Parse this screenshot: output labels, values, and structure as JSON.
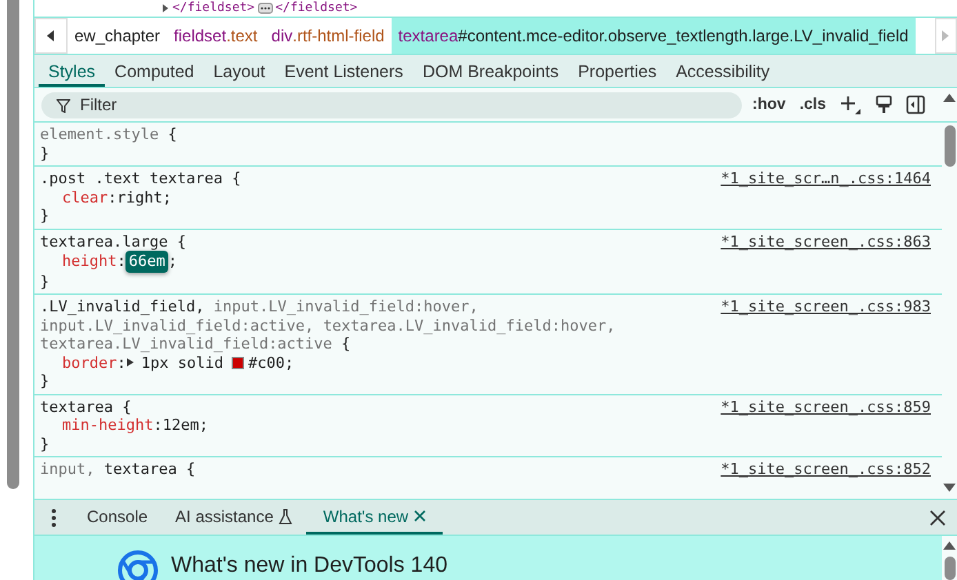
{
  "dom_fragment": {
    "open": "</fieldset>",
    "close": "</fieldset>"
  },
  "breadcrumbs": [
    {
      "suffix": "ew_chapter",
      "kind": "id",
      "selected": false
    },
    {
      "tag": "fieldset",
      "suffix": ".text",
      "kind": "class",
      "selected": false
    },
    {
      "tag": "div",
      "suffix": ".rtf-html-field",
      "kind": "class",
      "selected": false
    },
    {
      "tag": "textarea",
      "suffix": "#content.mce-editor.observe_textlength.large.LV_invalid_field",
      "kind": "id",
      "selected": true
    }
  ],
  "tabs": [
    {
      "label": "Styles",
      "selected": true
    },
    {
      "label": "Computed",
      "selected": false
    },
    {
      "label": "Layout",
      "selected": false
    },
    {
      "label": "Event Listeners",
      "selected": false
    },
    {
      "label": "DOM Breakpoints",
      "selected": false
    },
    {
      "label": "Properties",
      "selected": false
    },
    {
      "label": "Accessibility",
      "selected": false
    }
  ],
  "filter": {
    "placeholder": "Filter",
    "toggles": [
      ":hov",
      ".cls"
    ]
  },
  "rules": [
    {
      "selectors": [
        {
          "text": "element.style",
          "matched": false
        }
      ],
      "open": "{",
      "close": "}"
    },
    {
      "selectors": [
        {
          "text": ".post .text textarea",
          "matched": true
        }
      ],
      "open": "{",
      "source": "*1_site_scr…n_.css:1464",
      "declarations": [
        {
          "name": "clear",
          "colon": ":",
          "value": "right",
          "end": ";",
          "editing": false,
          "expandable": false
        }
      ],
      "close": "}"
    },
    {
      "selectors": [
        {
          "text": "textarea.large",
          "matched": true
        }
      ],
      "open": "{",
      "source": "*1_site_screen_.css:863",
      "declarations": [
        {
          "name": "height",
          "colon": ":",
          "value": "66em",
          "end": ";",
          "editing": true,
          "expandable": false
        }
      ],
      "close": "}"
    },
    {
      "selectors": [
        {
          "text": ".LV_invalid_field,",
          "matched": true
        },
        {
          "text": "input.LV_invalid_field:hover,",
          "matched": false
        },
        {
          "text": "input.LV_invalid_field:active,",
          "matched": false
        },
        {
          "text": "textarea.LV_invalid_field:hover,",
          "matched": false
        },
        {
          "text": "textarea.LV_invalid_field:active",
          "matched": false
        }
      ],
      "open": "{",
      "source": "*1_site_screen_.css:983",
      "declarations": [
        {
          "name": "border",
          "colon": ":",
          "value": "1px solid",
          "end": ";",
          "editing": false,
          "expandable": true,
          "swatch": {
            "color": "#cc0000",
            "text": "#c00"
          }
        }
      ],
      "close": "}"
    },
    {
      "selectors": [
        {
          "text": "textarea",
          "matched": true
        }
      ],
      "open": "{",
      "source": "*1_site_screen_.css:859",
      "declarations": [
        {
          "name": "min-height",
          "colon": ":",
          "value": "12em",
          "end": ";",
          "editing": false,
          "expandable": false
        }
      ],
      "close": "}"
    },
    {
      "selectors": [
        {
          "text": "input,",
          "matched": false
        },
        {
          "text": "textarea",
          "matched": true
        }
      ],
      "open": "{",
      "source": "*1_site_screen_.css:852"
    }
  ],
  "drawer": {
    "tabs": [
      {
        "label": "Console",
        "kind": "plain",
        "selected": false
      },
      {
        "label": "AI assistance",
        "kind": "experimental",
        "selected": false
      },
      {
        "label": "What's new",
        "kind": "closable",
        "selected": true
      }
    ],
    "whats_new": {
      "title": "What's new in DevTools 140"
    }
  }
}
